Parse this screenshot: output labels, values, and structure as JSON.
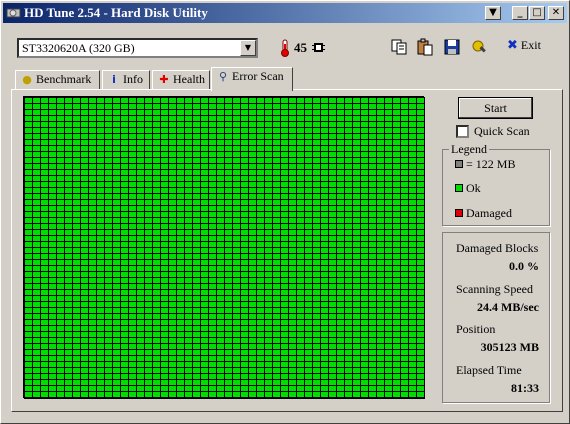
{
  "window": {
    "title": "HD Tune 2.54 - Hard Disk Utility"
  },
  "toolbar": {
    "drive": "ST3320620A (320 GB)",
    "temperature": "45",
    "exit_label": "Exit"
  },
  "tabs": [
    {
      "label": "Benchmark"
    },
    {
      "label": "Info"
    },
    {
      "label": "Health"
    },
    {
      "label": "Error Scan",
      "active": true
    }
  ],
  "scan": {
    "start_label": "Start",
    "quick_scan_label": "Quick Scan",
    "quick_scan_checked": false,
    "block_colors": {
      "ok": "#00dd00",
      "damaged": "#e00000",
      "unscanned": "#808080",
      "grid_line": "#000000"
    },
    "blocks_total": 2500,
    "blocks_ok": 2500
  },
  "legend": {
    "title": "Legend",
    "block_size": "= 122 MB",
    "ok": "Ok",
    "damaged": "Damaged"
  },
  "stats": {
    "damaged_blocks_label": "Damaged Blocks",
    "damaged_blocks_value": "0.0 %",
    "scanning_speed_label": "Scanning Speed",
    "scanning_speed_value": "24.4 MB/sec",
    "position_label": "Position",
    "position_value": "305123 MB",
    "elapsed_label": "Elapsed Time",
    "elapsed_value": "81:33"
  }
}
